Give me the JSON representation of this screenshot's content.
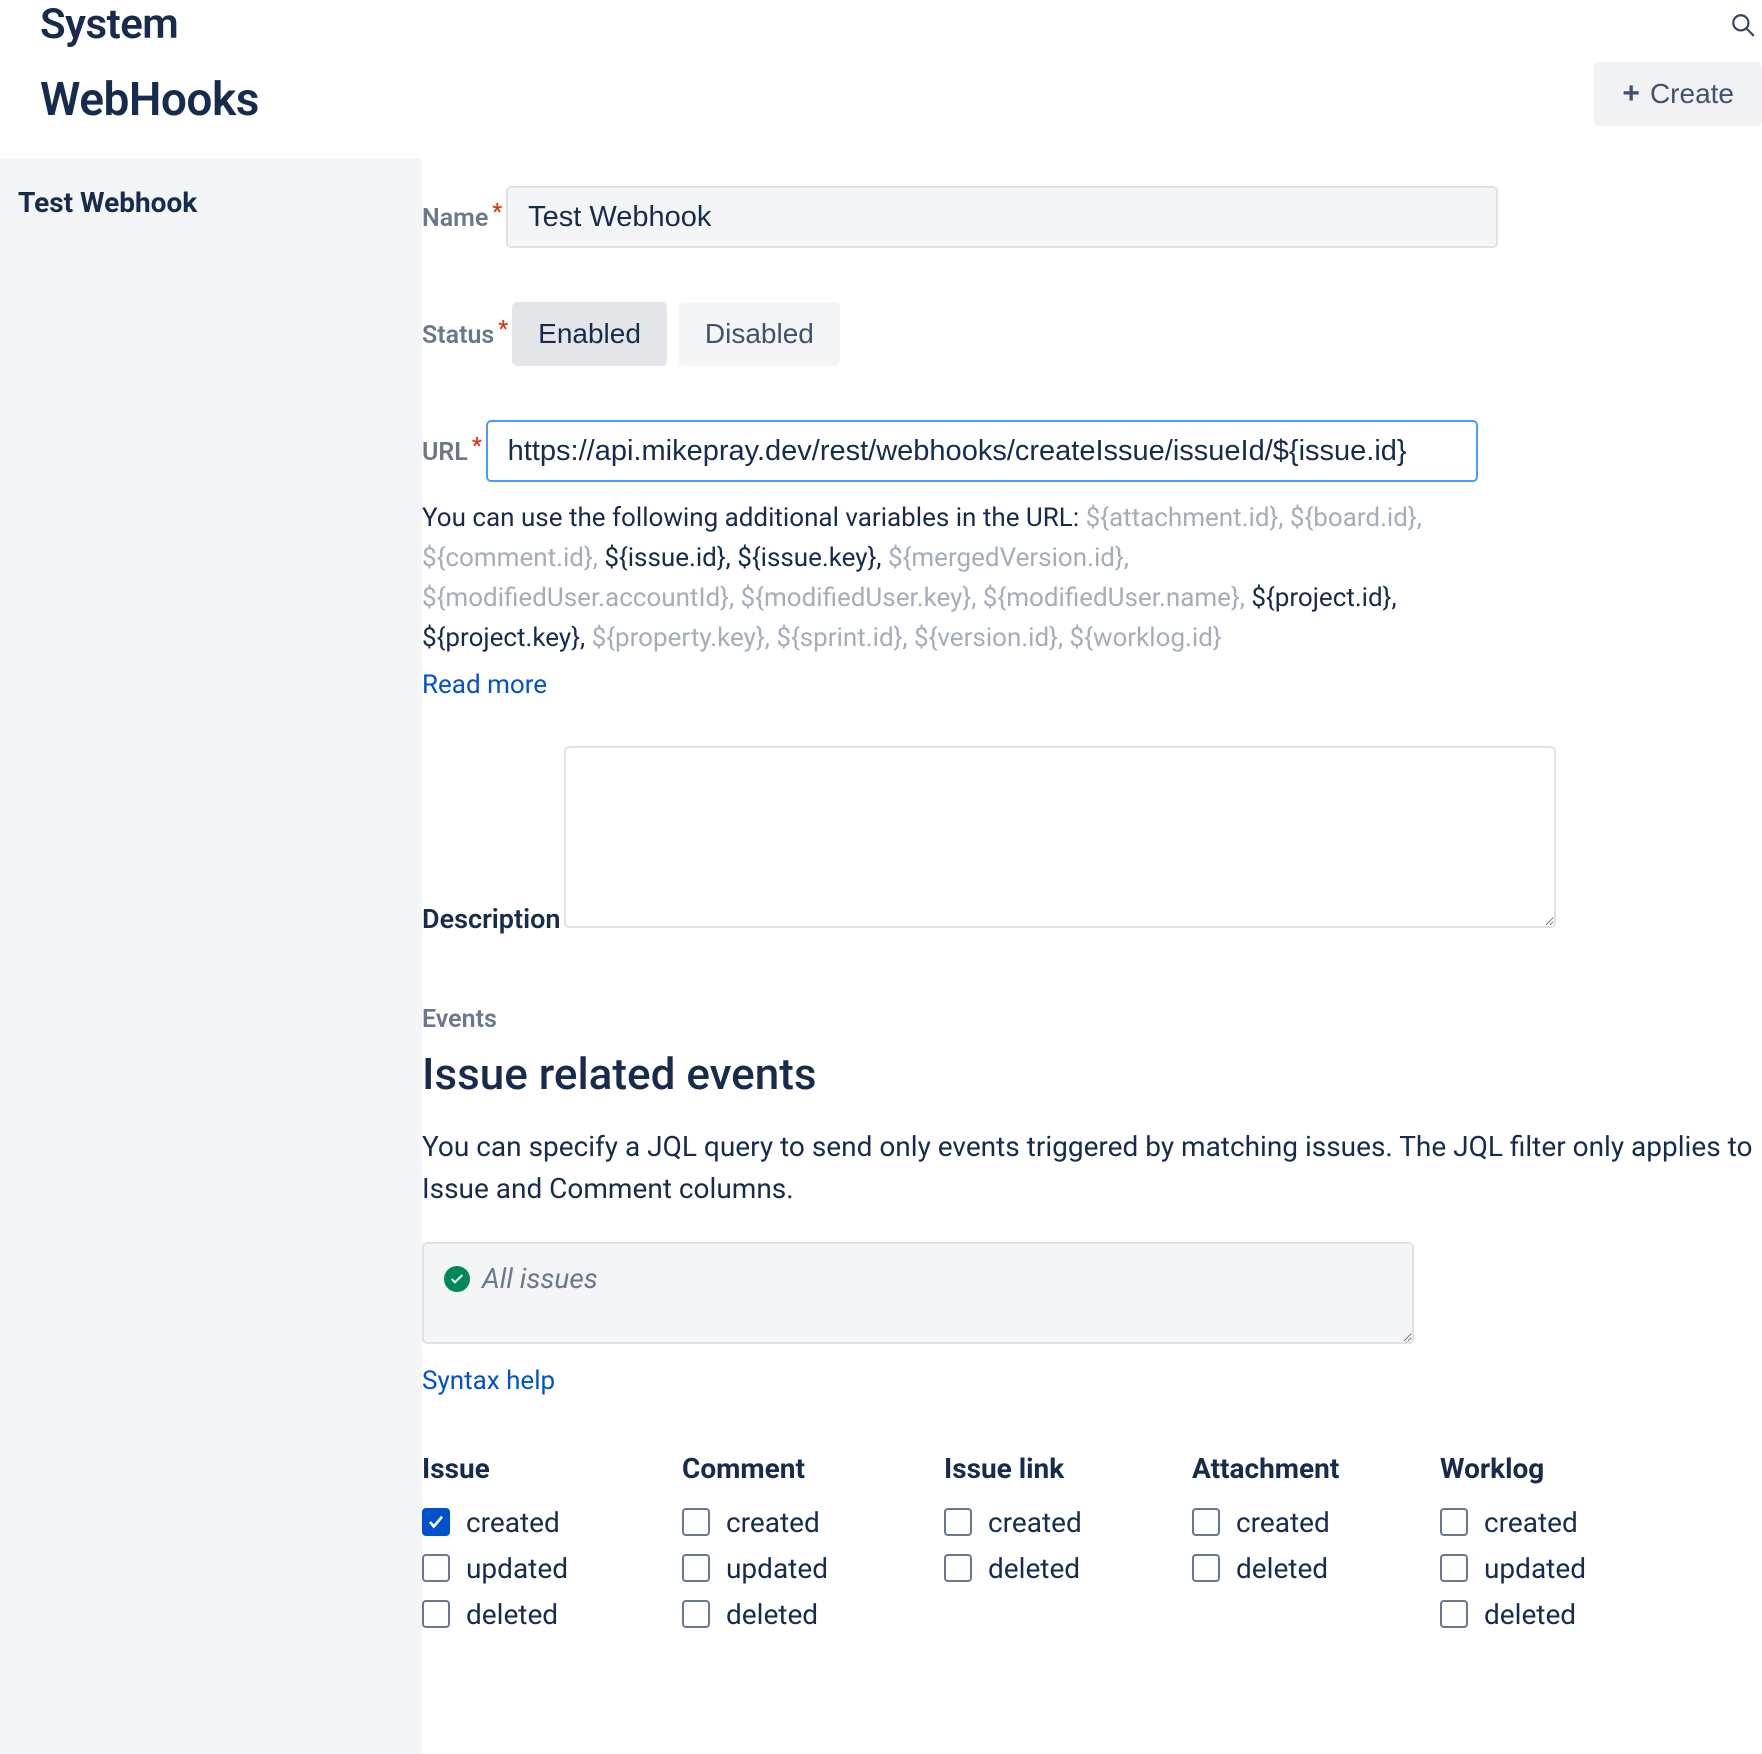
{
  "breadcrumb": "System",
  "page_title": "WebHooks",
  "create_label": "Create",
  "sidebar": {
    "item": "Test Webhook"
  },
  "name_field": {
    "label": "Name",
    "value": "Test Webhook"
  },
  "status_field": {
    "label": "Status",
    "enabled": "Enabled",
    "disabled": "Disabled"
  },
  "url_field": {
    "label": "URL",
    "value": "https://api.mikepray.dev/rest/webhooks/createIssue/issueId/${issue.id}"
  },
  "url_hint": {
    "intro": "You can use the following additional variables in the URL: ",
    "m1": "${attachment.id}, ${board.id}, ${comment.id}, ",
    "a1": "${issue.id}, ${issue.key}, ",
    "m2": "${mergedVersion.id}, ${modifiedUser.accountId}, ${modifiedUser.key}, ${modifiedUser.name}, ",
    "a2": "${project.id}, ${project.key}, ",
    "m3": "${property.key}, ${sprint.id}, ${version.id}, ${worklog.id}"
  },
  "read_more": "Read more",
  "description_field": {
    "label": "Description",
    "value": ""
  },
  "events": {
    "section_label": "Events",
    "title": "Issue related events",
    "desc": "You can specify a JQL query to send only events triggered by matching issues. The JQL filter only applies to Issue and Comment columns.",
    "jql_placeholder": "All issues",
    "syntax_help": "Syntax help"
  },
  "columns": [
    {
      "title": "Issue",
      "items": [
        {
          "label": "created",
          "checked": true
        },
        {
          "label": "updated",
          "checked": false
        },
        {
          "label": "deleted",
          "checked": false
        }
      ]
    },
    {
      "title": "Comment",
      "items": [
        {
          "label": "created",
          "checked": false
        },
        {
          "label": "updated",
          "checked": false
        },
        {
          "label": "deleted",
          "checked": false
        }
      ]
    },
    {
      "title": "Issue link",
      "items": [
        {
          "label": "created",
          "checked": false
        },
        {
          "label": "deleted",
          "checked": false
        }
      ]
    },
    {
      "title": "Attachment",
      "items": [
        {
          "label": "created",
          "checked": false
        },
        {
          "label": "deleted",
          "checked": false
        }
      ]
    },
    {
      "title": "Worklog",
      "items": [
        {
          "label": "created",
          "checked": false
        },
        {
          "label": "updated",
          "checked": false
        },
        {
          "label": "deleted",
          "checked": false
        }
      ]
    }
  ]
}
